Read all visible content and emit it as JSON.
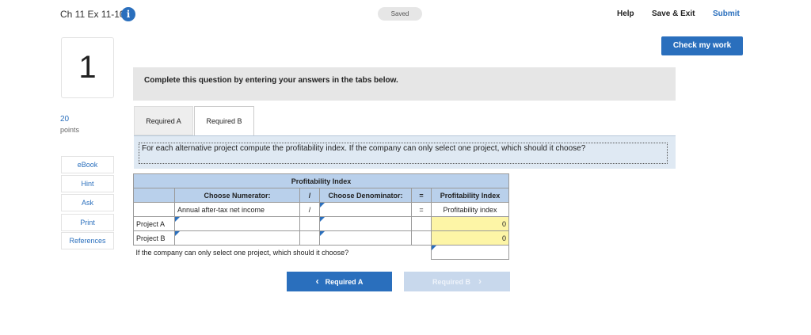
{
  "header": {
    "title": "Ch 11 Ex 11-10",
    "info_icon": "i",
    "saved": "Saved",
    "help": "Help",
    "save_exit": "Save & Exit",
    "submit": "Submit",
    "check": "Check my work"
  },
  "question": {
    "number": "1",
    "points": "20",
    "points_label": "points"
  },
  "sidebar": {
    "items": [
      "eBook",
      "Hint",
      "Ask",
      "Print",
      "References"
    ]
  },
  "instruction": "Complete this question by entering your answers in the tabs below.",
  "tabs": [
    "Required A",
    "Required B"
  ],
  "prompt": "For each alternative project compute the profitability index. If the company can only select one project, which should it choose?",
  "table": {
    "title": "Profitability Index",
    "header": {
      "numerator": "Choose Numerator:",
      "slash": "/",
      "denominator": "Choose Denominator:",
      "equals": "=",
      "result": "Profitability Index"
    },
    "subheader": {
      "numerator": "Annual after-tax net income",
      "slash": "/",
      "denominator": "",
      "equals": "=",
      "result": "Profitability index"
    },
    "rows": [
      {
        "label": "Project A",
        "numerator": "",
        "denominator": "",
        "result": "0"
      },
      {
        "label": "Project B",
        "numerator": "",
        "denominator": "",
        "result": "0"
      }
    ],
    "choice_question": "If the company can only select one project, which should it choose?",
    "choice_value": ""
  },
  "nav": {
    "prev_icon": "‹",
    "prev": "Required A",
    "next": "Required B",
    "next_icon": "›"
  }
}
